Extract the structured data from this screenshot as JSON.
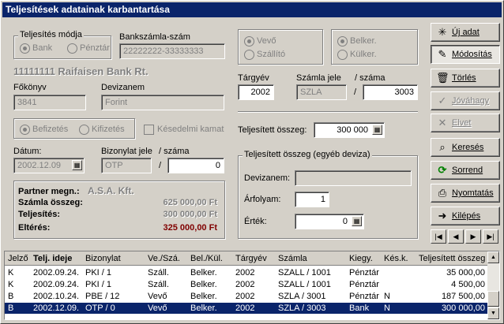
{
  "window": {
    "title": "Teljesítések adatainak karbantartása"
  },
  "payment_mode": {
    "title": "Teljesítés módja",
    "options": [
      "Bank",
      "Pénztár"
    ],
    "selected": "Bank"
  },
  "bank_account": {
    "label": "Bankszámla-szám",
    "value": "22222222-33333333"
  },
  "bank_name": "11111111 Raifaisen Bank Rt.",
  "ledger": {
    "label": "Főkönyv",
    "value": "3841"
  },
  "currency": {
    "label": "Devizanem",
    "value": "Forint"
  },
  "direction": {
    "options": [
      "Befizetés",
      "Kifizetés"
    ],
    "selected": "Befizetés"
  },
  "late_interest": {
    "label": "Késedelmi kamat"
  },
  "date": {
    "label": "Dátum:",
    "value": "2002.12.09"
  },
  "voucher": {
    "label": "Bizonylat jele",
    "number_label": "/  száma",
    "code": "OTP",
    "number": "0"
  },
  "summary": {
    "partner_label": "Partner megn.:",
    "partner_value": "A.S.A. Kft.",
    "invoice_total_label": "Számla összeg:",
    "invoice_total_value": "625 000,00 Ft",
    "settled_label": "Teljesítés:",
    "settled_value": "300 000,00 Ft",
    "difference_label": "Eltérés:",
    "difference_value": "325 000,00 Ft",
    "difference_color": "#800000"
  },
  "party_type": {
    "options": [
      "Vevő",
      "Szállító"
    ],
    "selected": "Vevő"
  },
  "location": {
    "options": [
      "Belker.",
      "Külker."
    ],
    "selected": "Belker."
  },
  "invoice": {
    "year_label": "Tárgyév",
    "year": "2002",
    "code_label": "Számla jele",
    "number_label": "/  száma",
    "code": "SZLA",
    "slash": "/",
    "number": "3003"
  },
  "settled_amount": {
    "label": "Teljesített összeg:",
    "value": "300 000"
  },
  "foreign": {
    "title": "Teljesített összeg (egyéb deviza)",
    "currency_label": "Devizanem:",
    "currency_value": "",
    "rate_label": "Árfolyam:",
    "rate_value": "1",
    "value_label": "Érték:",
    "value_value": "0"
  },
  "buttons": {
    "new": "Új adat",
    "modify": "Módosítás",
    "delete": "Törlés",
    "approve": "Jóváhagy",
    "discard": "Elvet",
    "search": "Keresés",
    "order": "Sorrend",
    "print": "Nyomtatás",
    "exit": "Kilépés"
  },
  "nav": {
    "first": "|◀",
    "prev": "◀",
    "next": "▶",
    "last": "▶|"
  },
  "grid": {
    "headers": [
      "Jelző",
      "Telj. ideje",
      "Bizonylat",
      "Ve./Szá.",
      "Bel./Kül.",
      "Tárgyév",
      "Számla",
      "Kiegy.",
      "Kés.k.",
      "Teljesített összeg"
    ],
    "rows": [
      [
        "K",
        "2002.09.24.",
        "PKI / 1",
        "Száll.",
        "Belker.",
        "2002",
        "SZALL / 1001",
        "Pénztár",
        "",
        "35 000,00"
      ],
      [
        "K",
        "2002.09.24.",
        "PKI / 1",
        "Száll.",
        "Belker.",
        "2002",
        "SZALL / 1001",
        "Pénztár",
        "",
        "4 500,00"
      ],
      [
        "B",
        "2002.10.24.",
        "PBE / 12",
        "Vevő",
        "Belker.",
        "2002",
        "SZLA / 3001",
        "Pénztár",
        "N",
        "187 500,00"
      ],
      [
        "B",
        "2002.12.09.",
        "OTP / 0",
        "Vevő",
        "Belker.",
        "2002",
        "SZLA / 3003",
        "Bank",
        "N",
        "300 000,00"
      ]
    ],
    "selected_row": 3
  }
}
